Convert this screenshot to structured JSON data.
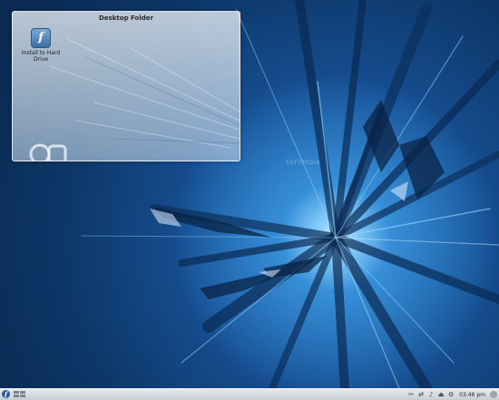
{
  "desktop": {
    "widget_title": "Desktop Folder",
    "icons": [
      {
        "label": "Install to Hard Drive",
        "icon": "fedora-install-icon"
      }
    ],
    "watermark": "SOFTPEDIA"
  },
  "panel": {
    "launcher_icon": "fedora-launcher-icon",
    "tray_icons": [
      "clipboard-icon",
      "network-icon",
      "volume-icon",
      "device-notifier-icon",
      "updates-icon"
    ],
    "clock": "03:48 pm"
  },
  "colors": {
    "wallpaper_base": "#164f93",
    "wallpaper_core": "#8fd3ff",
    "panel": "#d6d9dd"
  }
}
